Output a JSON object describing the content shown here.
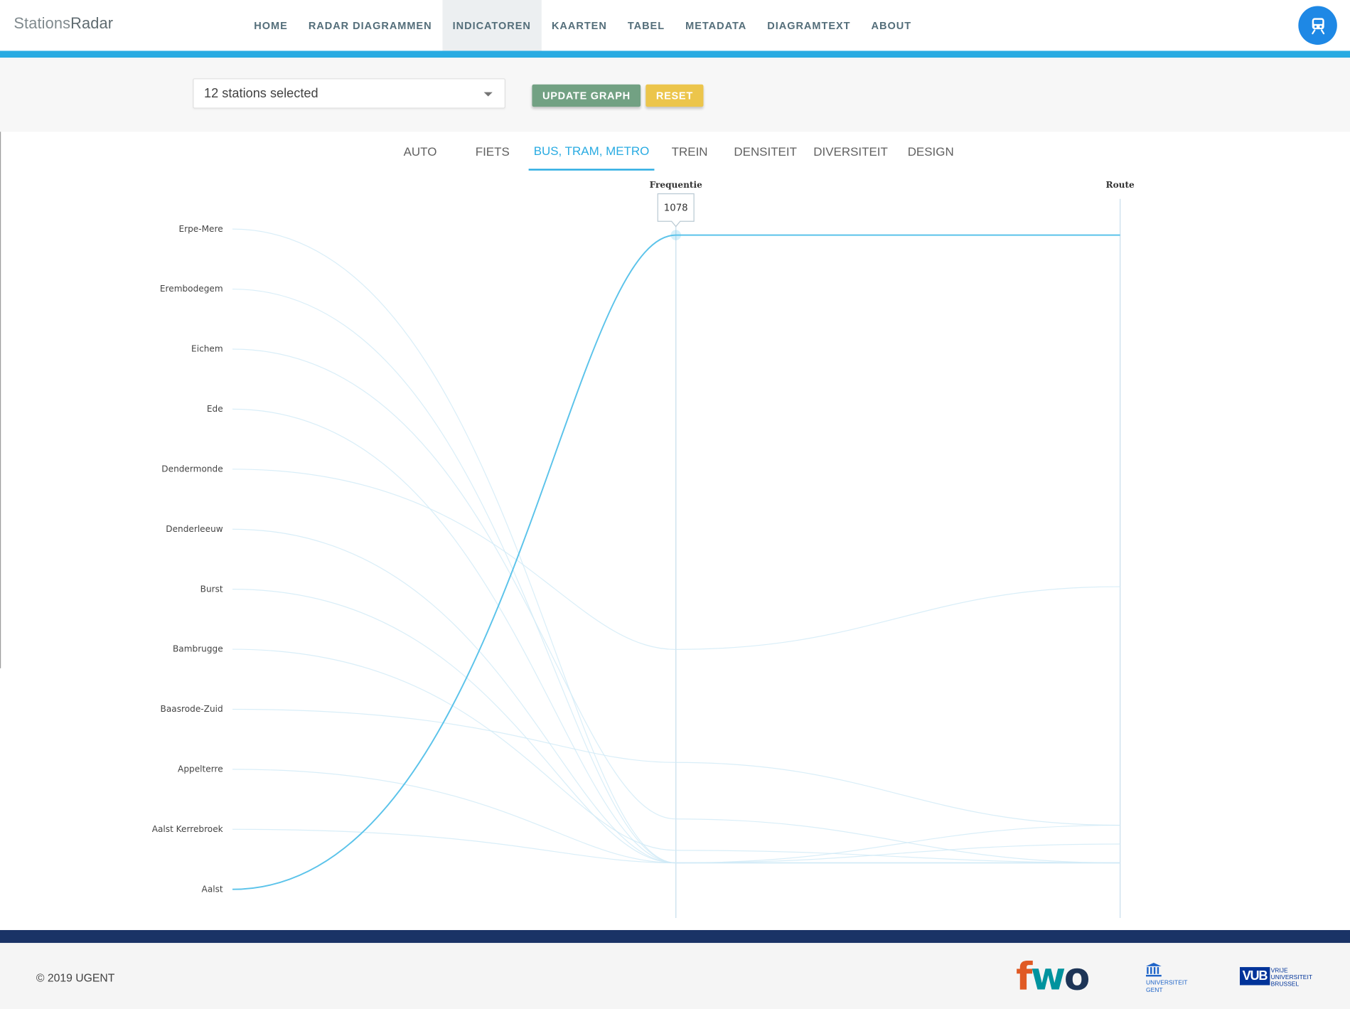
{
  "brand": {
    "part1": "Stations",
    "part2": "Radar"
  },
  "nav": {
    "items": [
      {
        "label": "HOME",
        "active": false
      },
      {
        "label": "RADAR DIAGRAMMEN",
        "active": false
      },
      {
        "label": "INDICATOREN",
        "active": true
      },
      {
        "label": "KAARTEN",
        "active": false
      },
      {
        "label": "TABEL",
        "active": false
      },
      {
        "label": "METADATA",
        "active": false
      },
      {
        "label": "DIAGRAMTEXT",
        "active": false
      },
      {
        "label": "ABOUT",
        "active": false
      }
    ],
    "avatar_icon": "train-icon"
  },
  "controls": {
    "station_select_value": "12 stations selected",
    "update_label": "UPDATE GRAPH",
    "reset_label": "RESET"
  },
  "tabs": [
    {
      "label": "AUTO",
      "active": false
    },
    {
      "label": "FIETS",
      "active": false
    },
    {
      "label": "BUS, TRAM, METRO",
      "active": true
    },
    {
      "label": "TREIN",
      "active": false
    },
    {
      "label": "DENSITEIT",
      "active": false
    },
    {
      "label": "DIVERSITEIT",
      "active": false
    },
    {
      "label": "DESIGN",
      "active": false
    }
  ],
  "chart_data": {
    "type": "parallel-coordinates",
    "axes": [
      "Frequentie",
      "Route"
    ],
    "stations": [
      "Erpe-Mere",
      "Erembodegem",
      "Eichem",
      "Ede",
      "Dendermonde",
      "Denderleeuw",
      "Burst",
      "Bambrugge",
      "Baasrode-Zuid",
      "Appelterre",
      "Aalst Kerrebroek",
      "Aalst"
    ],
    "highlighted_station": "Aalst",
    "tooltip_value": "1078",
    "series": [
      {
        "station": "Erpe-Mere",
        "values": [
          0.0,
          0.0
        ]
      },
      {
        "station": "Erembodegem",
        "values": [
          0.0,
          0.0
        ]
      },
      {
        "station": "Eichem",
        "values": [
          0.07,
          0.0
        ]
      },
      {
        "station": "Ede",
        "values": [
          0.0,
          0.0
        ]
      },
      {
        "station": "Dendermonde",
        "values": [
          0.34,
          0.44
        ]
      },
      {
        "station": "Denderleeuw",
        "values": [
          0.0,
          0.06
        ]
      },
      {
        "station": "Burst",
        "values": [
          0.0,
          0.03
        ]
      },
      {
        "station": "Bambrugge",
        "values": [
          0.02,
          0.0
        ]
      },
      {
        "station": "Baasrode-Zuid",
        "values": [
          0.16,
          0.06
        ]
      },
      {
        "station": "Appelterre",
        "values": [
          0.0,
          0.0
        ]
      },
      {
        "station": "Aalst Kerrebroek",
        "values": [
          0.0,
          0.0
        ]
      },
      {
        "station": "Aalst",
        "values": [
          1.0,
          1.0
        ]
      }
    ]
  },
  "footer": {
    "copyright": "© 2019 UGENT",
    "fwo_letters": [
      "f",
      "w",
      "o"
    ],
    "ugent_label_1": "UNIVERSITEIT",
    "ugent_label_2": "GENT",
    "vub_box": "VUB",
    "vub_label_1": "VRIJE",
    "vub_label_2": "UNIVERSITEIT",
    "vub_label_3": "BRUSSEL",
    "colors": {
      "fwo_f": "#e05a24",
      "fwo_w": "#00939e",
      "fwo_o": "#1d3557",
      "ugent": "#1e64c8",
      "vub": "#003399"
    }
  }
}
